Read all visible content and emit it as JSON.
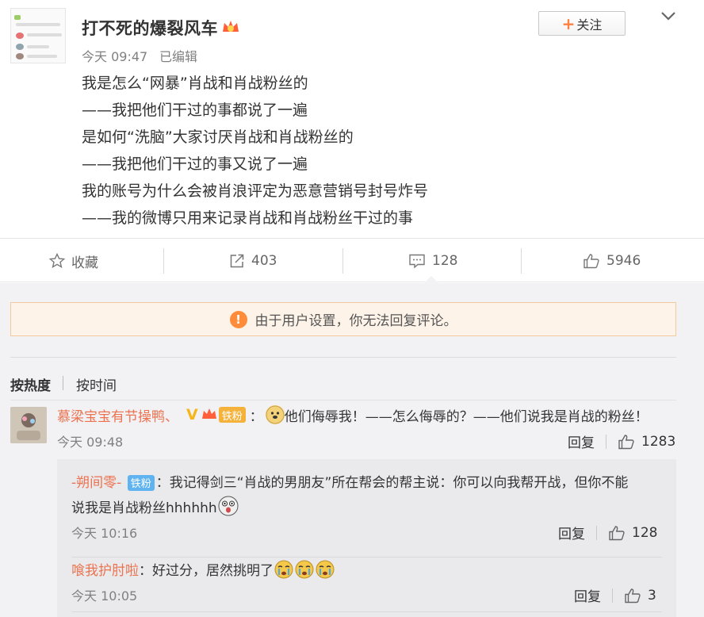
{
  "post": {
    "author": "打不死的爆裂风车",
    "time": "今天 09:47",
    "edited": "已编辑",
    "follow_label": "关注",
    "lines": [
      "我是怎么“网暴”肖战和肖战粉丝的",
      "——我把他们干过的事都说了一遍",
      "是如何“洗脑”大家讨厌肖战和肖战粉丝的",
      "——我把他们干过的事又说了一遍",
      "我的账号为什么会被肖浪评定为恶意营销号封号炸号",
      "——我的微博只用来记录肖战和肖战粉丝干过的事"
    ]
  },
  "actions": {
    "favorite_label": "收藏",
    "repost_count": "403",
    "comment_count": "128",
    "like_count": "5946"
  },
  "notice": {
    "text": "由于用户设置，你无法回复评论。"
  },
  "sort": {
    "hot_label": "按热度",
    "time_label": "按时间"
  },
  "comment": {
    "author": "慕梁宝宝有节操鸭、",
    "fan_badge": "铁粉",
    "text": "他们侮辱我！——怎么侮辱的？——他们说我是肖战的粉丝！",
    "time": "今天 09:48",
    "reply_label": "回复",
    "like_count": "1283"
  },
  "replies": [
    {
      "author": "-朔间零-",
      "fan_badge": "铁粉",
      "line1": "我记得剑三“肖战的男朋友”所在帮会的帮主说：你可以向我帮开战，但你不能",
      "line2": "说我是肖战粉丝hhhhhh",
      "time": "今天 10:16",
      "reply_label": "回复",
      "like_count": "128"
    },
    {
      "author": "喰我护肘啦",
      "text": "好过分，居然挑明了",
      "time": "今天 10:05",
      "reply_label": "回复",
      "like_count": "3"
    }
  ],
  "colors": {
    "link": "#eb7350",
    "accent": "#ff8140",
    "badge_gold": "#f4b23a",
    "badge_blue": "#5fb3f0"
  },
  "icons": [
    "star-icon",
    "repost-icon",
    "comment-icon",
    "thumb-up-icon",
    "chevron-down-icon",
    "warning-icon",
    "vip-crown-icon"
  ]
}
